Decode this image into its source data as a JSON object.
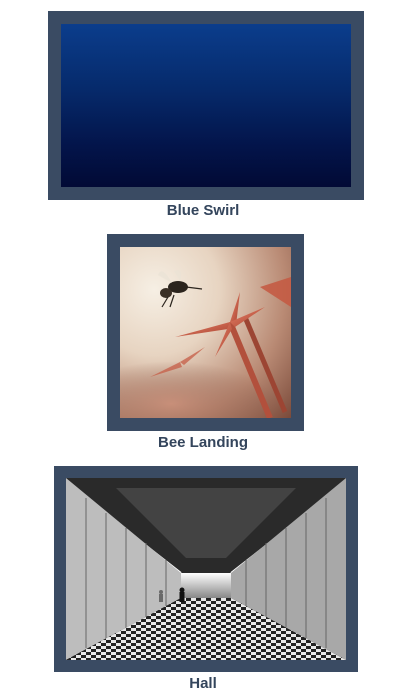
{
  "gallery": {
    "items": [
      {
        "caption": "Blue Swirl"
      },
      {
        "caption": "Bee Landing"
      },
      {
        "caption": "Hall"
      }
    ]
  },
  "colors": {
    "frame": "#3a4b63",
    "caption": "#34455c",
    "background": "#ffffff"
  }
}
